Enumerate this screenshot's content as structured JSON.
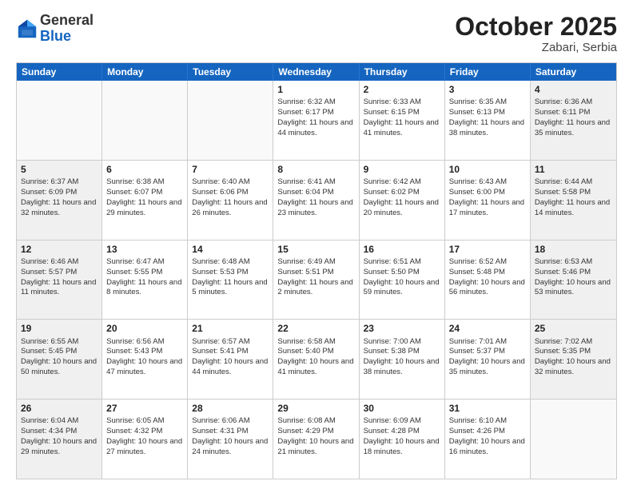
{
  "logo": {
    "general": "General",
    "blue": "Blue"
  },
  "header": {
    "month": "October 2025",
    "location": "Zabari, Serbia"
  },
  "weekdays": [
    "Sunday",
    "Monday",
    "Tuesday",
    "Wednesday",
    "Thursday",
    "Friday",
    "Saturday"
  ],
  "weeks": [
    [
      {
        "day": "",
        "empty": true
      },
      {
        "day": "",
        "empty": true
      },
      {
        "day": "",
        "empty": true
      },
      {
        "day": "1",
        "sunrise": "Sunrise: 6:32 AM",
        "sunset": "Sunset: 6:17 PM",
        "daylight": "Daylight: 11 hours and 44 minutes."
      },
      {
        "day": "2",
        "sunrise": "Sunrise: 6:33 AM",
        "sunset": "Sunset: 6:15 PM",
        "daylight": "Daylight: 11 hours and 41 minutes."
      },
      {
        "day": "3",
        "sunrise": "Sunrise: 6:35 AM",
        "sunset": "Sunset: 6:13 PM",
        "daylight": "Daylight: 11 hours and 38 minutes."
      },
      {
        "day": "4",
        "sunrise": "Sunrise: 6:36 AM",
        "sunset": "Sunset: 6:11 PM",
        "daylight": "Daylight: 11 hours and 35 minutes."
      }
    ],
    [
      {
        "day": "5",
        "sunrise": "Sunrise: 6:37 AM",
        "sunset": "Sunset: 6:09 PM",
        "daylight": "Daylight: 11 hours and 32 minutes."
      },
      {
        "day": "6",
        "sunrise": "Sunrise: 6:38 AM",
        "sunset": "Sunset: 6:07 PM",
        "daylight": "Daylight: 11 hours and 29 minutes."
      },
      {
        "day": "7",
        "sunrise": "Sunrise: 6:40 AM",
        "sunset": "Sunset: 6:06 PM",
        "daylight": "Daylight: 11 hours and 26 minutes."
      },
      {
        "day": "8",
        "sunrise": "Sunrise: 6:41 AM",
        "sunset": "Sunset: 6:04 PM",
        "daylight": "Daylight: 11 hours and 23 minutes."
      },
      {
        "day": "9",
        "sunrise": "Sunrise: 6:42 AM",
        "sunset": "Sunset: 6:02 PM",
        "daylight": "Daylight: 11 hours and 20 minutes."
      },
      {
        "day": "10",
        "sunrise": "Sunrise: 6:43 AM",
        "sunset": "Sunset: 6:00 PM",
        "daylight": "Daylight: 11 hours and 17 minutes."
      },
      {
        "day": "11",
        "sunrise": "Sunrise: 6:44 AM",
        "sunset": "Sunset: 5:58 PM",
        "daylight": "Daylight: 11 hours and 14 minutes."
      }
    ],
    [
      {
        "day": "12",
        "sunrise": "Sunrise: 6:46 AM",
        "sunset": "Sunset: 5:57 PM",
        "daylight": "Daylight: 11 hours and 11 minutes."
      },
      {
        "day": "13",
        "sunrise": "Sunrise: 6:47 AM",
        "sunset": "Sunset: 5:55 PM",
        "daylight": "Daylight: 11 hours and 8 minutes."
      },
      {
        "day": "14",
        "sunrise": "Sunrise: 6:48 AM",
        "sunset": "Sunset: 5:53 PM",
        "daylight": "Daylight: 11 hours and 5 minutes."
      },
      {
        "day": "15",
        "sunrise": "Sunrise: 6:49 AM",
        "sunset": "Sunset: 5:51 PM",
        "daylight": "Daylight: 11 hours and 2 minutes."
      },
      {
        "day": "16",
        "sunrise": "Sunrise: 6:51 AM",
        "sunset": "Sunset: 5:50 PM",
        "daylight": "Daylight: 10 hours and 59 minutes."
      },
      {
        "day": "17",
        "sunrise": "Sunrise: 6:52 AM",
        "sunset": "Sunset: 5:48 PM",
        "daylight": "Daylight: 10 hours and 56 minutes."
      },
      {
        "day": "18",
        "sunrise": "Sunrise: 6:53 AM",
        "sunset": "Sunset: 5:46 PM",
        "daylight": "Daylight: 10 hours and 53 minutes."
      }
    ],
    [
      {
        "day": "19",
        "sunrise": "Sunrise: 6:55 AM",
        "sunset": "Sunset: 5:45 PM",
        "daylight": "Daylight: 10 hours and 50 minutes."
      },
      {
        "day": "20",
        "sunrise": "Sunrise: 6:56 AM",
        "sunset": "Sunset: 5:43 PM",
        "daylight": "Daylight: 10 hours and 47 minutes."
      },
      {
        "day": "21",
        "sunrise": "Sunrise: 6:57 AM",
        "sunset": "Sunset: 5:41 PM",
        "daylight": "Daylight: 10 hours and 44 minutes."
      },
      {
        "day": "22",
        "sunrise": "Sunrise: 6:58 AM",
        "sunset": "Sunset: 5:40 PM",
        "daylight": "Daylight: 10 hours and 41 minutes."
      },
      {
        "day": "23",
        "sunrise": "Sunrise: 7:00 AM",
        "sunset": "Sunset: 5:38 PM",
        "daylight": "Daylight: 10 hours and 38 minutes."
      },
      {
        "day": "24",
        "sunrise": "Sunrise: 7:01 AM",
        "sunset": "Sunset: 5:37 PM",
        "daylight": "Daylight: 10 hours and 35 minutes."
      },
      {
        "day": "25",
        "sunrise": "Sunrise: 7:02 AM",
        "sunset": "Sunset: 5:35 PM",
        "daylight": "Daylight: 10 hours and 32 minutes."
      }
    ],
    [
      {
        "day": "26",
        "sunrise": "Sunrise: 6:04 AM",
        "sunset": "Sunset: 4:34 PM",
        "daylight": "Daylight: 10 hours and 29 minutes."
      },
      {
        "day": "27",
        "sunrise": "Sunrise: 6:05 AM",
        "sunset": "Sunset: 4:32 PM",
        "daylight": "Daylight: 10 hours and 27 minutes."
      },
      {
        "day": "28",
        "sunrise": "Sunrise: 6:06 AM",
        "sunset": "Sunset: 4:31 PM",
        "daylight": "Daylight: 10 hours and 24 minutes."
      },
      {
        "day": "29",
        "sunrise": "Sunrise: 6:08 AM",
        "sunset": "Sunset: 4:29 PM",
        "daylight": "Daylight: 10 hours and 21 minutes."
      },
      {
        "day": "30",
        "sunrise": "Sunrise: 6:09 AM",
        "sunset": "Sunset: 4:28 PM",
        "daylight": "Daylight: 10 hours and 18 minutes."
      },
      {
        "day": "31",
        "sunrise": "Sunrise: 6:10 AM",
        "sunset": "Sunset: 4:26 PM",
        "daylight": "Daylight: 10 hours and 16 minutes."
      },
      {
        "day": "",
        "empty": true
      }
    ]
  ]
}
